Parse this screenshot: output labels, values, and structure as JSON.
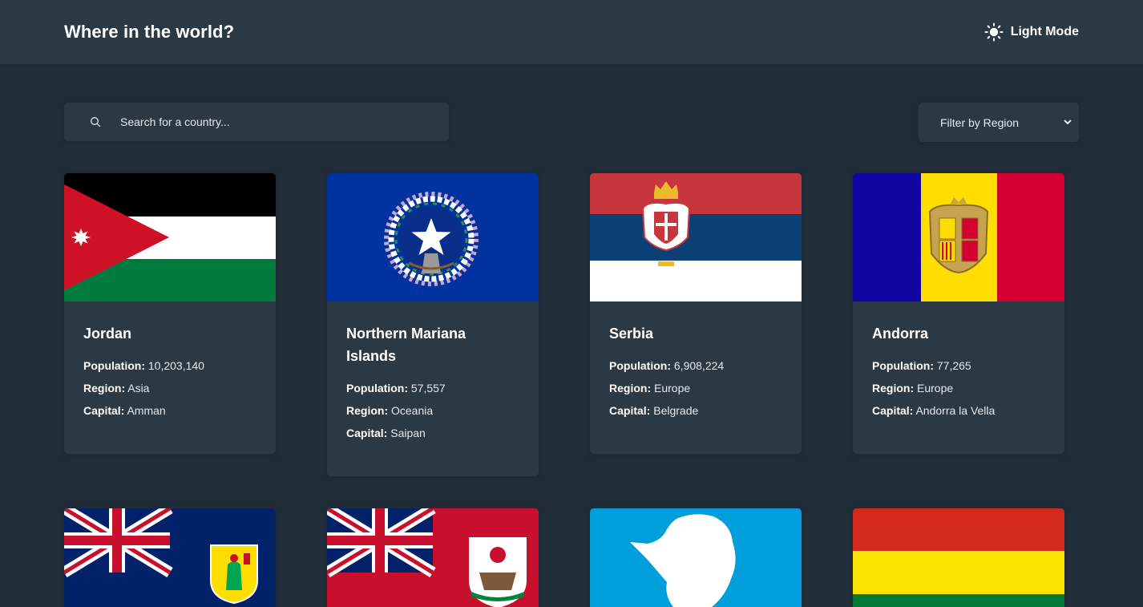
{
  "header": {
    "title": "Where in the world?",
    "mode_label": "Light Mode"
  },
  "search": {
    "placeholder": "Search for a country..."
  },
  "filter": {
    "label": "Filter by Region"
  },
  "labels": {
    "population": "Population:",
    "region": "Region:",
    "capital": "Capital:"
  },
  "countries": [
    {
      "name": "Jordan",
      "population": "10,203,140",
      "region": "Asia",
      "capital": "Amman"
    },
    {
      "name": "Northern Mariana Islands",
      "population": "57,557",
      "region": "Oceania",
      "capital": "Saipan"
    },
    {
      "name": "Serbia",
      "population": "6,908,224",
      "region": "Europe",
      "capital": "Belgrade"
    },
    {
      "name": "Andorra",
      "population": "77,265",
      "region": "Europe",
      "capital": "Andorra la Vella"
    }
  ],
  "colors": {
    "background": "#202c37",
    "elements": "#2b3945",
    "text": "#ffffff"
  }
}
